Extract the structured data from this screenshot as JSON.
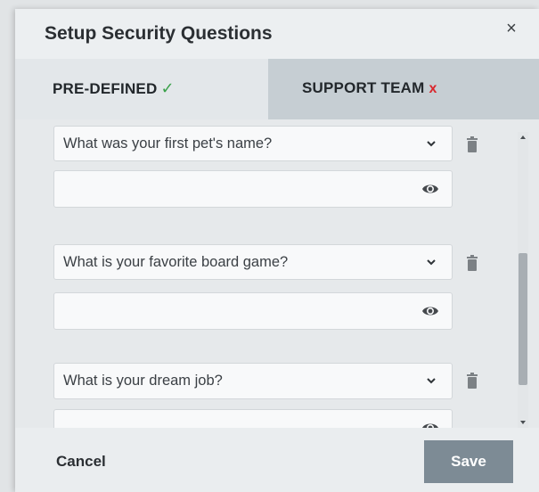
{
  "dialog": {
    "title": "Setup Security Questions",
    "close_label": "×"
  },
  "tabs": [
    {
      "label": "PRE-DEFINED",
      "mark": "✓",
      "active": true
    },
    {
      "label": "SUPPORT TEAM",
      "mark": "x",
      "active": false
    }
  ],
  "questions": [
    {
      "question": "What was your first pet's name?",
      "answer": ""
    },
    {
      "question": "What is your favorite board game?",
      "answer": ""
    },
    {
      "question": "What is your dream job?",
      "answer": ""
    }
  ],
  "footer": {
    "cancel_label": "Cancel",
    "save_label": "Save"
  },
  "colors": {
    "check": "#3aa14a",
    "x_mark": "#d9262c",
    "save_button": "#7d8b95"
  },
  "icons": {
    "close": "close-icon",
    "chevron": "chevron-down-icon",
    "eye": "eye-icon",
    "trash": "trash-icon"
  }
}
